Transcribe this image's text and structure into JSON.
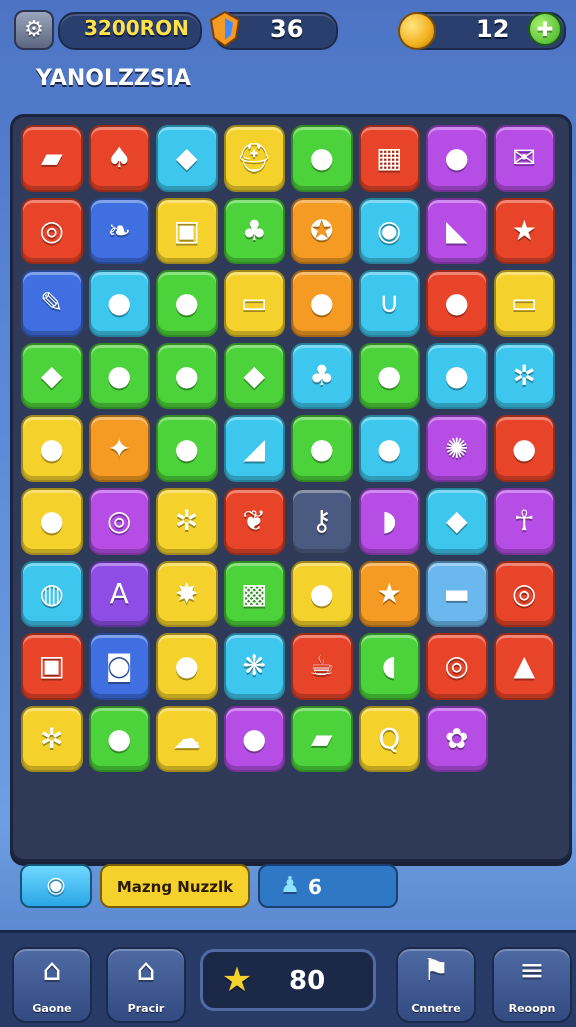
{
  "hud": {
    "coins_label": "3200RON",
    "gems_value": "36",
    "lives_value": "12"
  },
  "title": "YANOLZZSIA",
  "board": {
    "tiles": [
      {
        "color": "#e8442a",
        "icon": "battery-icon",
        "glyph": "▰"
      },
      {
        "color": "#e8442a",
        "icon": "pepper-icon",
        "glyph": "♠"
      },
      {
        "color": "#3ec7ee",
        "icon": "crystal-icon",
        "glyph": "◆"
      },
      {
        "color": "#f5d22b",
        "icon": "helmet-icon",
        "glyph": "⛑"
      },
      {
        "color": "#4cd23a",
        "icon": "blue-orb-icon",
        "glyph": "●"
      },
      {
        "color": "#e8442a",
        "icon": "window-icon",
        "glyph": "▦"
      },
      {
        "color": "#b64ee6",
        "icon": "apple-icon",
        "glyph": "●"
      },
      {
        "color": "#b64ee6",
        "icon": "envelope-icon",
        "glyph": "✉"
      },
      {
        "color": "#e8442a",
        "icon": "ring-icon",
        "glyph": "◎"
      },
      {
        "color": "#3f6fe0",
        "icon": "leaf-icon",
        "glyph": "❧"
      },
      {
        "color": "#f5d22b",
        "icon": "toolbox-icon",
        "glyph": "▣"
      },
      {
        "color": "#4cd23a",
        "icon": "bell-icon",
        "glyph": "♣"
      },
      {
        "color": "#f59a22",
        "icon": "coin-icon",
        "glyph": "✪"
      },
      {
        "color": "#3ec7ee",
        "icon": "gem-ring-icon",
        "glyph": "◉"
      },
      {
        "color": "#b64ee6",
        "icon": "bookmark-icon",
        "glyph": "◣"
      },
      {
        "color": "#e8442a",
        "icon": "star-icon",
        "glyph": "★"
      },
      {
        "color": "#3f6fe0",
        "icon": "brush-icon",
        "glyph": "✎"
      },
      {
        "color": "#3ec7ee",
        "icon": "fruit-icon",
        "glyph": "●"
      },
      {
        "color": "#4cd23a",
        "icon": "green-orb-icon",
        "glyph": "●"
      },
      {
        "color": "#f5d22b",
        "icon": "cassette-icon",
        "glyph": "▭"
      },
      {
        "color": "#f59a22",
        "icon": "orange-orb-icon",
        "glyph": "●"
      },
      {
        "color": "#3ec7ee",
        "icon": "magnet-icon",
        "glyph": "∪"
      },
      {
        "color": "#e8442a",
        "icon": "seed-icon",
        "glyph": "●"
      },
      {
        "color": "#f5d22b",
        "icon": "scroll-icon",
        "glyph": "▭"
      },
      {
        "color": "#4cd23a",
        "icon": "gem-icon",
        "glyph": "◆"
      },
      {
        "color": "#4cd23a",
        "icon": "green-ball-icon",
        "glyph": "●"
      },
      {
        "color": "#4cd23a",
        "icon": "purple-ball-icon",
        "glyph": "●"
      },
      {
        "color": "#4cd23a",
        "icon": "emerald-icon",
        "glyph": "◆"
      },
      {
        "color": "#3ec7ee",
        "icon": "sprout-icon",
        "glyph": "♣"
      },
      {
        "color": "#4cd23a",
        "icon": "strawberry-icon",
        "glyph": "●"
      },
      {
        "color": "#3ec7ee",
        "icon": "acorn-icon",
        "glyph": "●"
      },
      {
        "color": "#3ec7ee",
        "icon": "gear-icon",
        "glyph": "✲"
      },
      {
        "color": "#f5d22b",
        "icon": "orange-ball-icon",
        "glyph": "●"
      },
      {
        "color": "#f59a22",
        "icon": "carrot-icon",
        "glyph": "✦"
      },
      {
        "color": "#4cd23a",
        "icon": "lemon-icon",
        "glyph": "●"
      },
      {
        "color": "#3ec7ee",
        "icon": "shark-fin-icon",
        "glyph": "◢"
      },
      {
        "color": "#4cd23a",
        "icon": "blueberry-icon",
        "glyph": "●"
      },
      {
        "color": "#3ec7ee",
        "icon": "pear-icon",
        "glyph": "●"
      },
      {
        "color": "#b64ee6",
        "icon": "bubbles-icon",
        "glyph": "✺"
      },
      {
        "color": "#e8442a",
        "icon": "tomato-icon",
        "glyph": "●"
      },
      {
        "color": "#f5d22b",
        "icon": "lemon-drop-icon",
        "glyph": "●"
      },
      {
        "color": "#b64ee6",
        "icon": "snail-shell-icon",
        "glyph": "◎"
      },
      {
        "color": "#f5d22b",
        "icon": "cog-icon",
        "glyph": "✲"
      },
      {
        "color": "#e8442a",
        "icon": "feather-icon",
        "glyph": "❦"
      },
      {
        "color": "#4a5a80",
        "icon": "keys-icon",
        "glyph": "⚷"
      },
      {
        "color": "#b64ee6",
        "icon": "banana-icon",
        "glyph": "◗"
      },
      {
        "color": "#3ec7ee",
        "icon": "water-drop-icon",
        "glyph": "◆"
      },
      {
        "color": "#b64ee6",
        "icon": "figure-icon",
        "glyph": "☥"
      },
      {
        "color": "#3ec7ee",
        "icon": "ring-gem-icon",
        "glyph": "◍"
      },
      {
        "color": "#8e4ee6",
        "icon": "letter-a-icon",
        "glyph": "A"
      },
      {
        "color": "#f5d22b",
        "icon": "sunburst-icon",
        "glyph": "✸"
      },
      {
        "color": "#4cd23a",
        "icon": "box-icon",
        "glyph": "▩"
      },
      {
        "color": "#f5d22b",
        "icon": "potion-icon",
        "glyph": "●"
      },
      {
        "color": "#f59a22",
        "icon": "gold-star-icon",
        "glyph": "★"
      },
      {
        "color": "#6ab8ee",
        "icon": "candy-icon",
        "glyph": "▬"
      },
      {
        "color": "#e8442a",
        "icon": "donut-icon",
        "glyph": "◎"
      },
      {
        "color": "#e8442a",
        "icon": "lantern-icon",
        "glyph": "▣"
      },
      {
        "color": "#3f6fe0",
        "icon": "lens-icon",
        "glyph": "◙"
      },
      {
        "color": "#f5d22b",
        "icon": "chili-icon",
        "glyph": "●"
      },
      {
        "color": "#3ec7ee",
        "icon": "splash-icon",
        "glyph": "❋"
      },
      {
        "color": "#e8442a",
        "icon": "mug-icon",
        "glyph": "☕"
      },
      {
        "color": "#4cd23a",
        "icon": "tag-icon",
        "glyph": "◖"
      },
      {
        "color": "#e8442a",
        "icon": "life-ring-icon",
        "glyph": "◎"
      },
      {
        "color": "#e8442a",
        "icon": "warning-icon",
        "glyph": "▲"
      },
      {
        "color": "#f5d22b",
        "icon": "sprocket-icon",
        "glyph": "✲"
      },
      {
        "color": "#4cd23a",
        "icon": "plum-icon",
        "glyph": "●"
      },
      {
        "color": "#f5d22b",
        "icon": "cloud-cake-icon",
        "glyph": "☁"
      },
      {
        "color": "#b64ee6",
        "icon": "peach-icon",
        "glyph": "●"
      },
      {
        "color": "#4cd23a",
        "icon": "folder-icon",
        "glyph": "▰"
      },
      {
        "color": "#f5d22b",
        "icon": "letter-q-icon",
        "glyph": "Q"
      },
      {
        "color": "#b64ee6",
        "icon": "flower-icon",
        "glyph": "✿"
      }
    ]
  },
  "status": {
    "level_name": "Mazng Nuzzlk",
    "moves_value": "6"
  },
  "nav": {
    "items": [
      {
        "label": "Gaone",
        "icon": "home-icon",
        "glyph": "⌂"
      },
      {
        "label": "Pracir",
        "icon": "house-arrow-icon",
        "glyph": "⌂"
      },
      {
        "label": "Cnnetre",
        "icon": "flag-icon",
        "glyph": "⚑"
      },
      {
        "label": "Reoopn",
        "icon": "menu-icon",
        "glyph": "≡"
      }
    ],
    "score_value": "80"
  },
  "colors": {
    "board_bg": "#2f3a58",
    "nav_bg": "#283a66",
    "accent_yellow": "#f5d22b"
  }
}
